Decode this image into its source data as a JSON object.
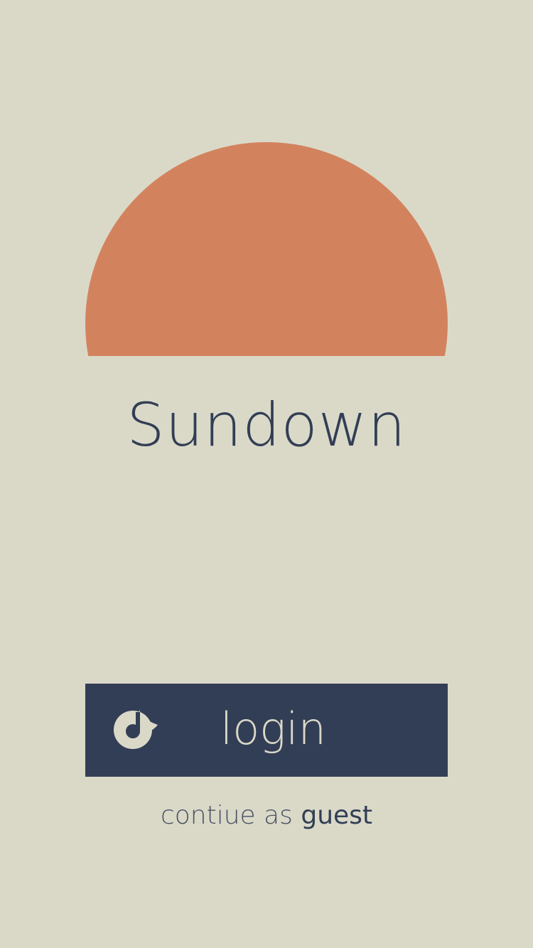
{
  "app": {
    "title": "Sundown"
  },
  "login": {
    "label": "login",
    "icon": "rdio-logo-icon"
  },
  "guest": {
    "prefix": "contiue as",
    "link_label": "guest"
  },
  "colors": {
    "background": "#dad9c8",
    "sun": "#d2835e",
    "navy": "#323e55"
  }
}
